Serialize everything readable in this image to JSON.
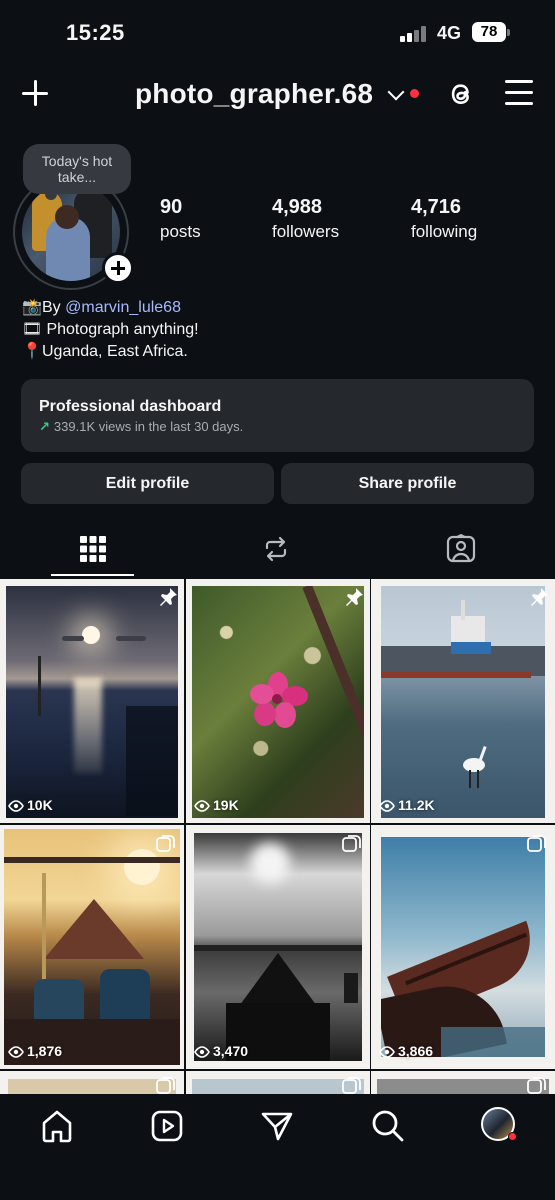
{
  "status_bar": {
    "time": "15:25",
    "network": "4G",
    "battery": "78"
  },
  "header": {
    "username": "photo_grapher.68"
  },
  "profile": {
    "note": "Today's hot take...",
    "stats": [
      {
        "value": "90",
        "label": "posts"
      },
      {
        "value": "4,988",
        "label": "followers"
      },
      {
        "value": "4,716",
        "label": "following"
      }
    ],
    "bio": {
      "line1_prefix": "By ",
      "mention": "@marvin_lule68",
      "line2": "Photograph anything!",
      "line3": "Uganda, East Africa."
    }
  },
  "dashboard": {
    "title": "Professional dashboard",
    "subtitle": "339.1K views in the last 30 days."
  },
  "buttons": {
    "edit": "Edit profile",
    "share": "Share profile"
  },
  "tabs": [
    {
      "name": "posts-grid",
      "icon": "grid-icon",
      "active": true
    },
    {
      "name": "reposts",
      "icon": "repost-icon",
      "active": false
    },
    {
      "name": "tagged",
      "icon": "tagged-person-icon",
      "active": false
    }
  ],
  "posts": [
    {
      "views": "10K",
      "badge": "pin-icon"
    },
    {
      "views": "19K",
      "badge": "pin-icon"
    },
    {
      "views": "11.2K",
      "badge": "pin-icon"
    },
    {
      "views": "1,876",
      "badge": "carousel-icon"
    },
    {
      "views": "3,470",
      "badge": "carousel-icon"
    },
    {
      "views": "3,866",
      "badge": "carousel-icon"
    }
  ],
  "nav": [
    "home-icon",
    "reels-icon",
    "direct-icon",
    "search-icon",
    "profile-avatar"
  ]
}
